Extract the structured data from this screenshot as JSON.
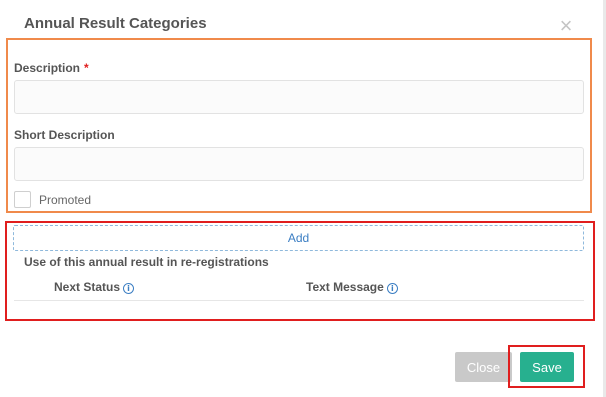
{
  "modal": {
    "title": "Annual Result Categories",
    "close_icon": "close-x-icon"
  },
  "form": {
    "description": {
      "label": "Description",
      "required_mark": "*",
      "value": "",
      "placeholder": ""
    },
    "short_description": {
      "label": "Short Description",
      "value": "",
      "placeholder": ""
    },
    "promoted": {
      "label": "Promoted",
      "checked": false
    }
  },
  "reregistration": {
    "add_label": "Add",
    "title": "Use of this annual result in re-registrations",
    "columns": [
      {
        "label": "Next Status",
        "icon": "info-icon"
      },
      {
        "label": "Text Message",
        "icon": "info-icon"
      }
    ],
    "info_glyph": "i"
  },
  "footer": {
    "close_label": "Close",
    "save_label": "Save"
  },
  "colors": {
    "accent": "#27b08f",
    "link": "#3b7ec3",
    "required": "#e01e1e",
    "highlight_orange": "#f08a4b",
    "highlight_red": "#e01e1e"
  }
}
